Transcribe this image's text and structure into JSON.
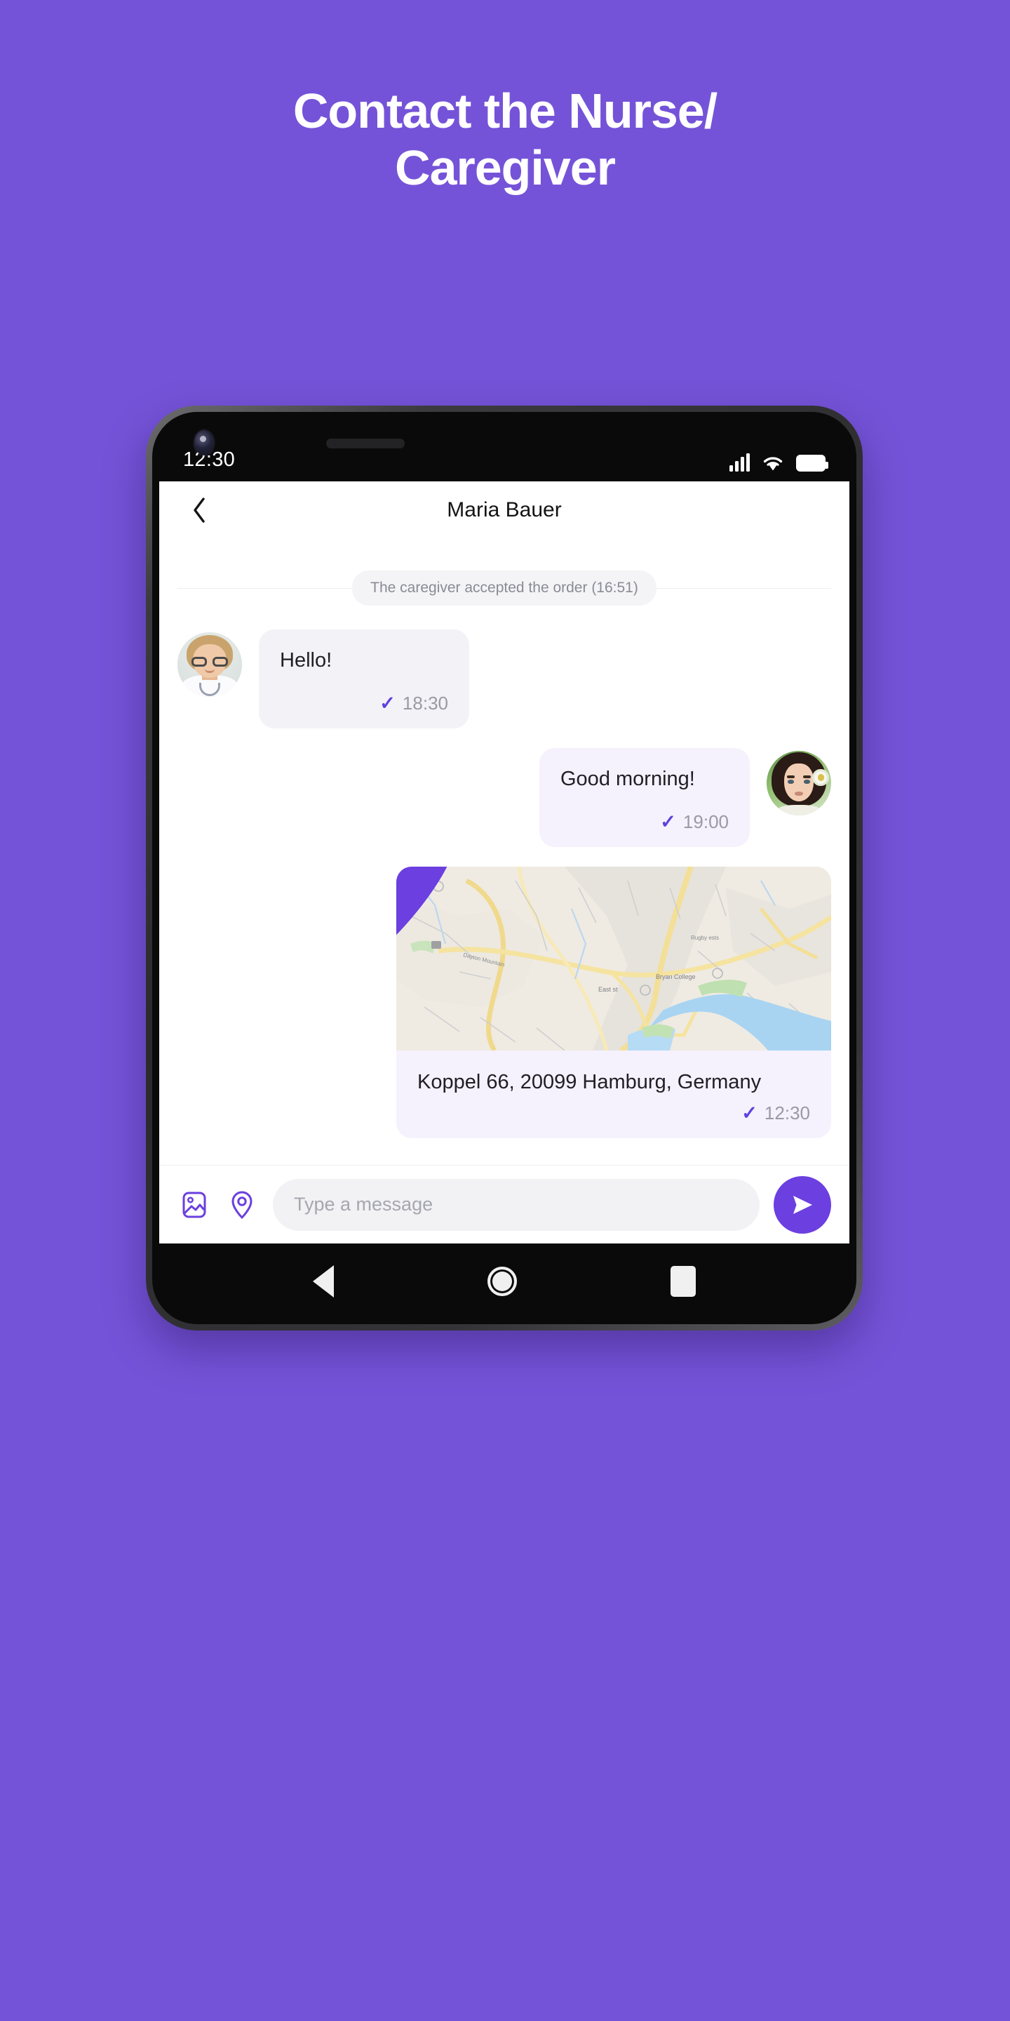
{
  "page": {
    "background_color": "#7553D8",
    "headline_line1": "Contact the Nurse/",
    "headline_line2": "Caregiver"
  },
  "phone": {
    "status_bar": {
      "time": "12:30",
      "signal_icon": "cellular-signal-icon",
      "wifi_icon": "wifi-icon",
      "battery_icon": "battery-full-icon"
    },
    "nav_bar": {
      "back_icon": "android-back-icon",
      "home_icon": "android-home-icon",
      "recents_icon": "android-recents-icon"
    }
  },
  "app": {
    "appbar": {
      "back_icon": "chevron-left-icon",
      "title": "Maria Bauer"
    },
    "system_message": "The caregiver accepted the order (16:51)",
    "messages": [
      {
        "id": "msg-hello",
        "side": "in",
        "avatar": "nurse-avatar",
        "text": "Hello!",
        "time": "18:30",
        "status_icon": "check-icon"
      },
      {
        "id": "msg-good-morning",
        "side": "out",
        "avatar": "client-avatar",
        "text": "Good morning!",
        "time": "19:00",
        "status_icon": "check-icon"
      },
      {
        "id": "msg-location",
        "side": "out",
        "type": "location",
        "map_icon": "map-pin-icon",
        "text": "Koppel 66, 20099 Hamburg, Germany",
        "time": "12:30",
        "status_icon": "check-icon"
      }
    ],
    "composer": {
      "image_icon": "image-attachment-icon",
      "location_icon": "location-pin-icon",
      "input_placeholder": "Type a message",
      "input_value": "",
      "send_icon": "send-icon"
    },
    "colors": {
      "accent": "#6B3FE0",
      "tick": "#6040DE",
      "bubble_in": "#F3F2F7",
      "bubble_out": "#F5F1FD",
      "time_text": "#9A9AA3"
    }
  }
}
